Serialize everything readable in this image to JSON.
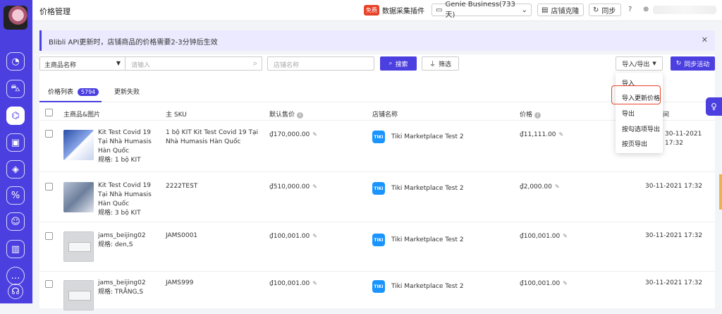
{
  "topbar": {
    "title": "价格管理",
    "free_badge": "免费",
    "plugin_label": "数据采集插件",
    "business_label": "Genie Business(733 天)",
    "clone_label": "店铺克隆",
    "sync_label": "同步"
  },
  "notice": {
    "text": "Blibli API更新时，店铺商品的价格需要2-3分钟后生效"
  },
  "filters": {
    "field_select": "主商品名称",
    "search_placeholder": "请输入",
    "shop_placeholder": "店铺名称",
    "search_label": "搜索",
    "filter_label": "筛选",
    "import_export_label": "导入/导出",
    "sync_activity_label": "同步活动"
  },
  "tabs": [
    {
      "label": "价格列表",
      "count": "5794"
    },
    {
      "label": "更新失败"
    }
  ],
  "table": {
    "headers": [
      "主商品&图片",
      "主 SKU",
      "默认售价",
      "店铺名称",
      "价格",
      "间"
    ],
    "rows": [
      {
        "name": "Kit Test Covid 19 Tại Nhà Humasis Hàn Quốc",
        "spec": "规格: 1 bộ KIT",
        "sku": "1 bộ KIT Kit Test Covid 19 Tại Nhà Humasis Hàn Quốc",
        "default_price": "₫170,000.00",
        "shop": "Tiki Marketplace Test 2",
        "price": "₫11,111.00",
        "time": "30-11-2021 17:32"
      },
      {
        "name": "Kit Test Covid 19 Tại Nhà Humasis Hàn Quốc",
        "spec": "规格: 3 bộ KIT",
        "sku": "2222TEST",
        "default_price": "₫510,000.00",
        "shop": "Tiki Marketplace Test 2",
        "price": "₫2,000.00",
        "time": "30-11-2021 17:32"
      },
      {
        "name": "jams_beijing02",
        "spec": "规格: den,S",
        "sku": "JAMS0001",
        "default_price": "₫100,001.00",
        "shop": "Tiki Marketplace Test 2",
        "price": "₫100,001.00",
        "time": "30-11-2021 17:32"
      },
      {
        "name": "jams_beijing02",
        "spec": "规格: TRẮNG,S",
        "sku": "JAMS999",
        "default_price": "₫100,001.00",
        "shop": "Tiki Marketplace Test 2",
        "price": "₫100,001.00",
        "time": "30-11-2021 17:32"
      }
    ]
  },
  "dropdown": {
    "items": [
      "导入",
      "导入更新价格",
      "导出",
      "按勾选项导出",
      "按页导出"
    ]
  },
  "tiki_logo_text": "TIKI",
  "colors": {
    "accent": "#4b3fe0",
    "highlight": "#e8442b",
    "tiki": "#1a94ff"
  }
}
